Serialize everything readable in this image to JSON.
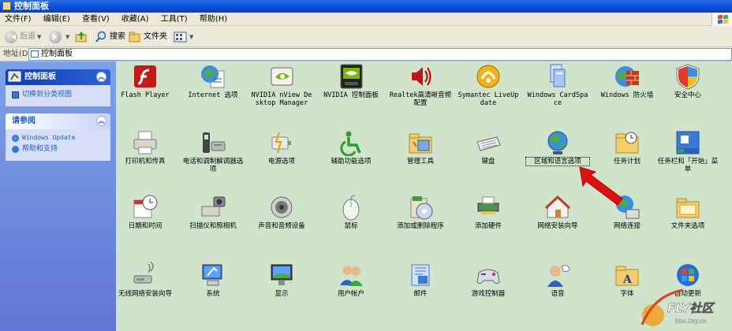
{
  "window": {
    "title": "控制面板"
  },
  "menu": [
    "文件(F)",
    "编辑(E)",
    "查看(V)",
    "收藏(A)",
    "工具(T)",
    "帮助(H)"
  ],
  "toolbar": {
    "back": "后退",
    "search": "搜索",
    "folders": "文件夹"
  },
  "address": {
    "label": "地址(D)",
    "value": "控制面板"
  },
  "sidebar": {
    "panel1": {
      "title": "控制面板",
      "link": "切换到分类视图"
    },
    "panel2": {
      "title": "请参阅",
      "links": [
        "Windows Update",
        "帮助和支持"
      ]
    }
  },
  "items": [
    {
      "label": "Flash Player",
      "icon": "flash-icon"
    },
    {
      "label": "Internet 选项",
      "icon": "globe-doc-icon"
    },
    {
      "label": "NVIDIA nView Desktop Manager",
      "icon": "nvidia-icon"
    },
    {
      "label": "NVIDIA 控制面板",
      "icon": "nvidia-panel-icon"
    },
    {
      "label": "Realtek高清晰音频配置",
      "icon": "speaker-icon"
    },
    {
      "label": "Symantec LiveUpdate",
      "icon": "liveupdate-icon"
    },
    {
      "label": "Windows CardSpace",
      "icon": "cardspace-icon"
    },
    {
      "label": "Windows 防火墙",
      "icon": "firewall-icon"
    },
    {
      "label": "安全中心",
      "icon": "shield-icon"
    },
    {
      "label": "打印机和传真",
      "icon": "printer-icon"
    },
    {
      "label": "电话和调制解调器选项",
      "icon": "phone-icon"
    },
    {
      "label": "电源选项",
      "icon": "power-icon"
    },
    {
      "label": "辅助功能选项",
      "icon": "accessibility-icon"
    },
    {
      "label": "管理工具",
      "icon": "admin-tools-icon"
    },
    {
      "label": "键盘",
      "icon": "keyboard-icon"
    },
    {
      "label": "区域和语言选项",
      "icon": "globe-icon"
    },
    {
      "label": "任务计划",
      "icon": "task-folder-icon"
    },
    {
      "label": "任务栏和「开始」菜单",
      "icon": "taskbar-icon"
    },
    {
      "label": "日期和时间",
      "icon": "clock-icon"
    },
    {
      "label": "扫描仪和照相机",
      "icon": "scanner-icon"
    },
    {
      "label": "声音和音频设备",
      "icon": "sound-icon"
    },
    {
      "label": "鼠标",
      "icon": "mouse-icon"
    },
    {
      "label": "添加或删除程序",
      "icon": "add-remove-icon"
    },
    {
      "label": "添加硬件",
      "icon": "hardware-icon"
    },
    {
      "label": "网络安装向导",
      "icon": "network-house-icon"
    },
    {
      "label": "网络连接",
      "icon": "network-globe-icon"
    },
    {
      "label": "文件夹选项",
      "icon": "folder-options-icon"
    },
    {
      "label": "无线网络安装向导",
      "icon": "wireless-icon"
    },
    {
      "label": "系统",
      "icon": "system-icon"
    },
    {
      "label": "显示",
      "icon": "display-icon"
    },
    {
      "label": "用户帐户",
      "icon": "users-icon"
    },
    {
      "label": "邮件",
      "icon": "mail-icon"
    },
    {
      "label": "游戏控制器",
      "icon": "gamepad-icon"
    },
    {
      "label": "语音",
      "icon": "speech-icon"
    },
    {
      "label": "字体",
      "icon": "fonts-icon"
    },
    {
      "label": "自动更新",
      "icon": "update-icon"
    }
  ],
  "watermark": {
    "brand": "FLY社区",
    "url": "bbs.0xy.cn"
  },
  "colors": {
    "title": "#0a4fd6",
    "main_bg": "#d0e4cc",
    "sidebar": "#7ba2e7",
    "arrow": "#e01010"
  }
}
